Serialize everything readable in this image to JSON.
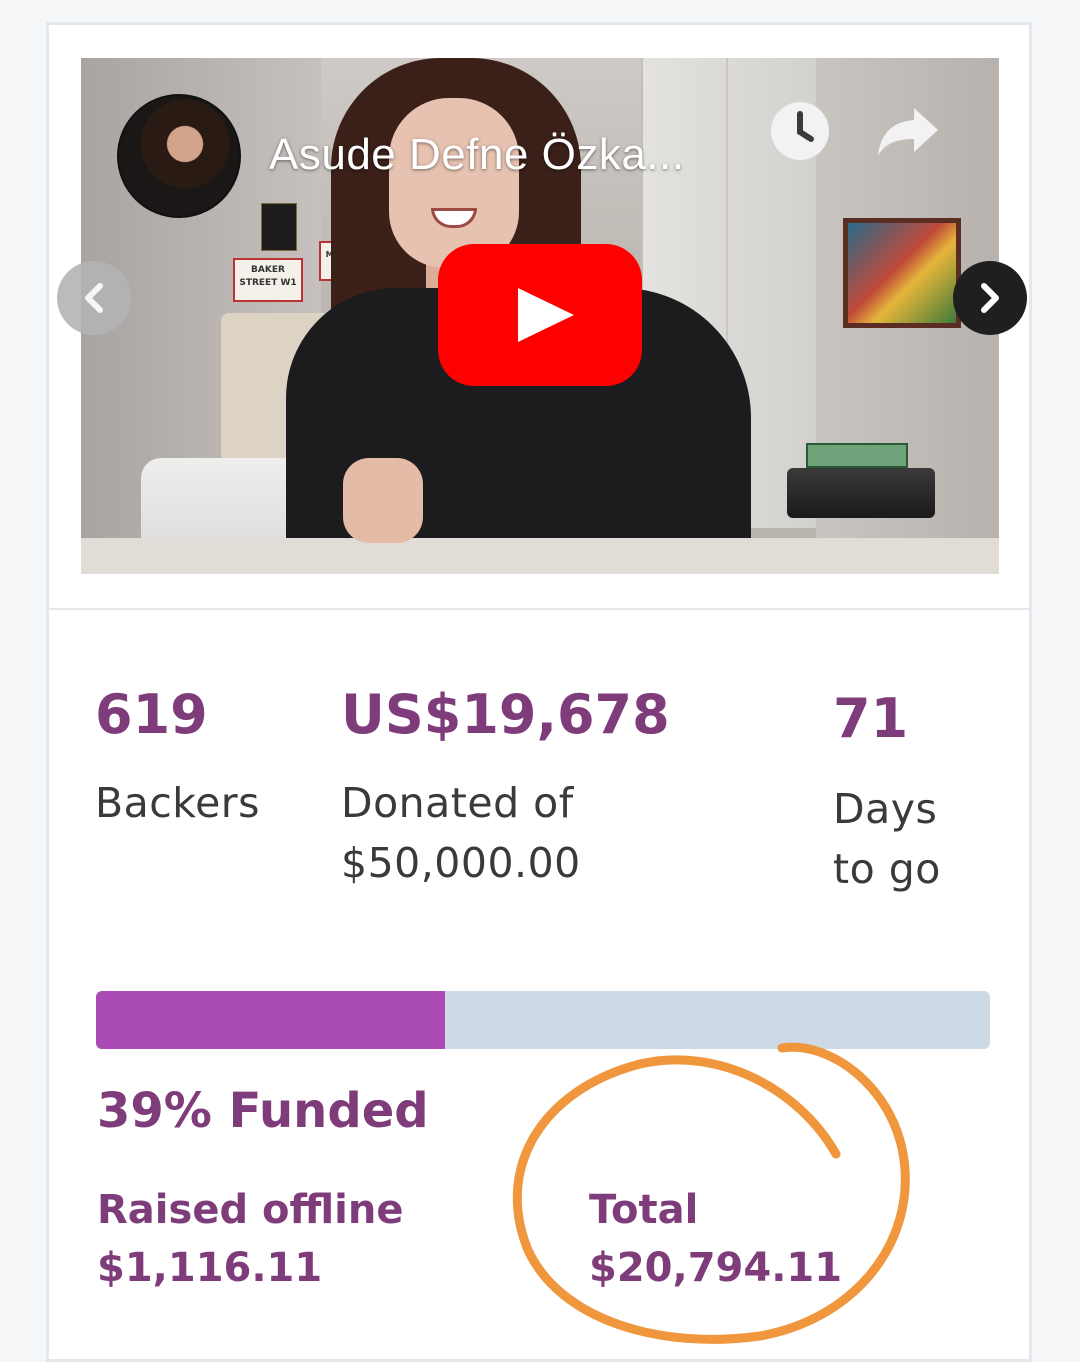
{
  "video": {
    "title": "Asude Defne Özka...",
    "sign_left": "BAKER STREET W1",
    "sign_right": "MIND THE GAP"
  },
  "icons": {
    "channel_avatar": "avatar",
    "watch_later": "clock-icon",
    "share": "share-icon",
    "play": "play-icon",
    "prev": "chevron-left-icon",
    "next": "chevron-right-icon"
  },
  "stats": {
    "backers": {
      "value": "619",
      "label": "Backers"
    },
    "donated": {
      "value": "US$19,678",
      "label_line1": "Donated of",
      "label_line2": "$50,000.00"
    },
    "days": {
      "value": "71",
      "label_line1": "Days",
      "label_line2": "to go"
    }
  },
  "progress": {
    "percent": 39,
    "funded_label": "39% Funded"
  },
  "totals": {
    "raised_offline_label": "Raised offline",
    "raised_offline_value": "$1,116.11",
    "total_label": "Total",
    "total_value": "$20,794.11"
  },
  "colors": {
    "accent": "#7e3c7a",
    "progress_fill": "#ab4bb6",
    "progress_track": "#cdd9e4",
    "annotation": "#f0963c",
    "youtube_red": "#ff0000"
  }
}
